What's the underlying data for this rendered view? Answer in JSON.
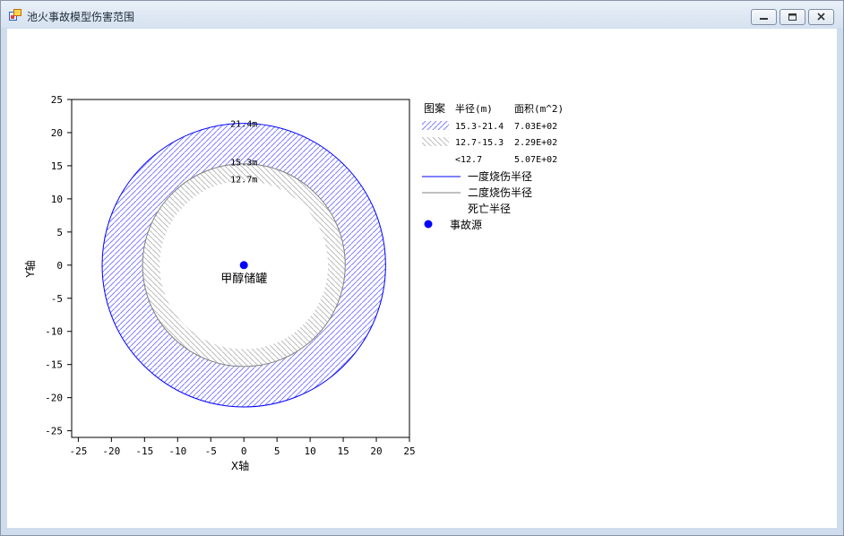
{
  "window": {
    "title": "池火事故模型伤害范围"
  },
  "colors": {
    "outer_ring": "#0000ff",
    "outer_hatch": "#7f7fff",
    "middle_ring": "#808080",
    "middle_hatch": "#bdbdbd",
    "source_point": "#0000ff"
  },
  "chart_data": {
    "type": "scatter",
    "xlabel": "X轴",
    "ylabel": "Y轴",
    "xlim": [
      -26,
      25
    ],
    "ylim": [
      -26,
      25
    ],
    "xticks": [
      -25,
      -20,
      -15,
      -10,
      -5,
      0,
      5,
      10,
      15,
      20,
      25
    ],
    "yticks": [
      -25,
      -20,
      -15,
      -10,
      -5,
      0,
      5,
      10,
      15,
      20,
      25
    ],
    "grid": false,
    "legend_position": "right",
    "circles": [
      {
        "radius": 21.4,
        "label": "21.4m"
      },
      {
        "radius": 15.3,
        "label": "15.3m"
      },
      {
        "radius": 12.7,
        "label": "12.7m"
      }
    ],
    "source": {
      "x": 0,
      "y": 0,
      "label": "甲醇储罐"
    },
    "legend": {
      "header": [
        "图案",
        "半径(m)",
        "面积(m^2)"
      ],
      "rows": [
        {
          "range": "15.3-21.4",
          "area": "7.03E+02"
        },
        {
          "range": "12.7-15.3",
          "area": "2.29E+02"
        },
        {
          "range": "<12.7",
          "area": "5.07E+02"
        }
      ],
      "lines": [
        "一度烧伤半径",
        "二度烧伤半径",
        "死亡半径"
      ],
      "point": "事故源"
    }
  }
}
